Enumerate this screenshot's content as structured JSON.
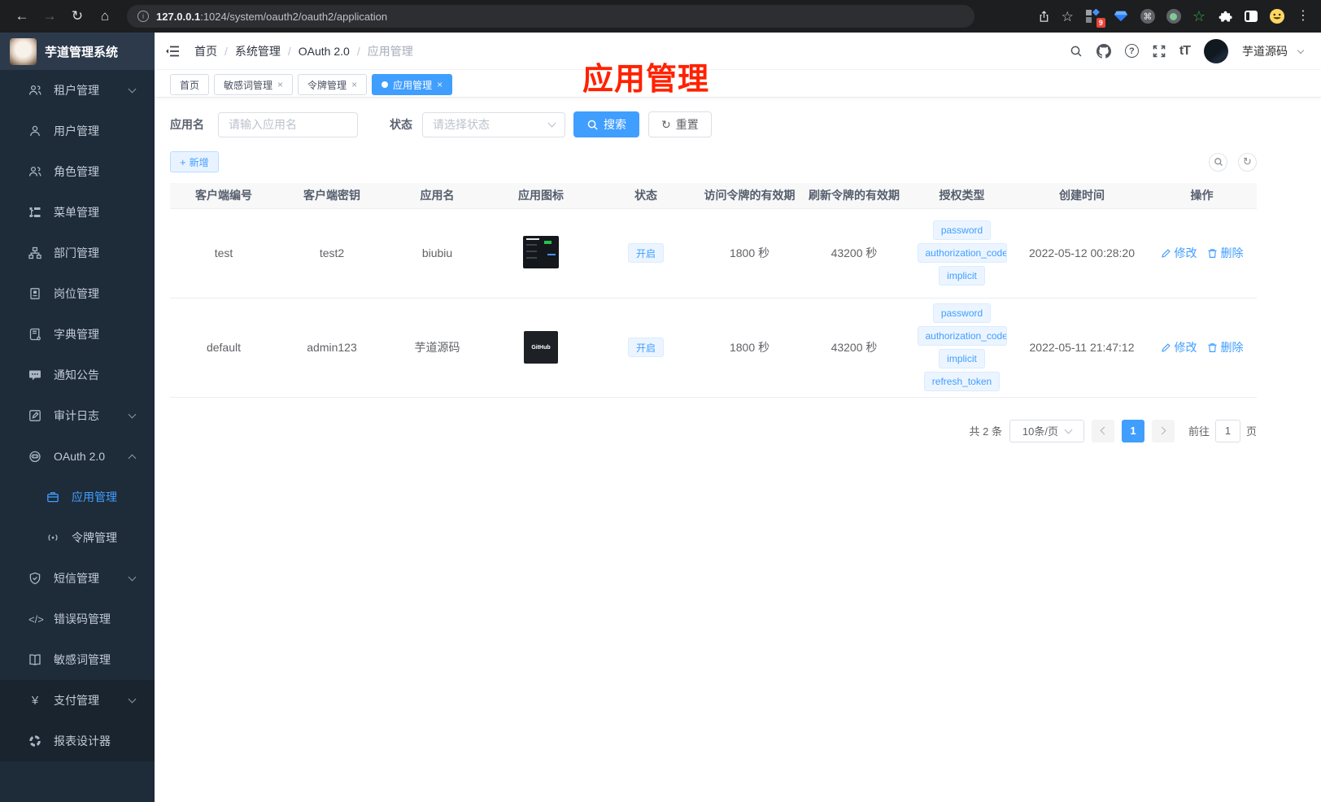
{
  "browser": {
    "url_host": "127.0.0.1",
    "url_path": ":1024/system/oauth2/oauth2/application",
    "extension_badge": "9"
  },
  "icons": {
    "back": "←",
    "forward": "→",
    "reload": "↻",
    "home": "⌂",
    "info": "i",
    "star": "☆",
    "more": "⋮",
    "command": "⌘",
    "question": "?",
    "font_size": "tT",
    "plus": "+",
    "close": "×",
    "code": "</>",
    "yen": "¥"
  },
  "sidebar": {
    "title": "芋道管理系统",
    "items": [
      {
        "label": "租户管理"
      },
      {
        "label": "用户管理"
      },
      {
        "label": "角色管理"
      },
      {
        "label": "菜单管理"
      },
      {
        "label": "部门管理"
      },
      {
        "label": "岗位管理"
      },
      {
        "label": "字典管理"
      },
      {
        "label": "通知公告"
      },
      {
        "label": "审计日志"
      },
      {
        "label": "OAuth 2.0"
      },
      {
        "label": "短信管理"
      },
      {
        "label": "错误码管理"
      },
      {
        "label": "敏感词管理"
      },
      {
        "label": "支付管理"
      },
      {
        "label": "报表设计器"
      }
    ],
    "oauth_children": [
      {
        "label": "应用管理",
        "active": true
      },
      {
        "label": "令牌管理"
      }
    ]
  },
  "header": {
    "breadcrumb": [
      "首页",
      "系统管理",
      "OAuth 2.0",
      "应用管理"
    ],
    "separator": "/",
    "username": "芋道源码"
  },
  "tabs": {
    "items": [
      {
        "label": "首页"
      },
      {
        "label": "敏感词管理",
        "closable": true
      },
      {
        "label": "令牌管理",
        "closable": true
      },
      {
        "label": "应用管理",
        "closable": true,
        "active": true
      }
    ]
  },
  "annotation": {
    "text": "应用管理",
    "color": "#ff2100"
  },
  "filters": {
    "name_label": "应用名",
    "name_placeholder": "请输入应用名",
    "status_label": "状态",
    "status_placeholder": "请选择状态",
    "search_label": "搜索",
    "reset_label": "重置"
  },
  "toolbar": {
    "add_label": "新增"
  },
  "table": {
    "columns": [
      "客户端编号",
      "客户端密钥",
      "应用名",
      "应用图标",
      "状态",
      "访问令牌的有效期",
      "刷新令牌的有效期",
      "授权类型",
      "创建时间",
      "操作"
    ],
    "action_edit": "修改",
    "action_delete": "删除",
    "rows": [
      {
        "client_id": "test",
        "secret": "test2",
        "name": "biubiu",
        "status": "开启",
        "access_ttl": "1800 秒",
        "refresh_ttl": "43200 秒",
        "grants": [
          "password",
          "authorization_code",
          "implicit"
        ],
        "created": "2022-05-12 00:28:20"
      },
      {
        "client_id": "default",
        "secret": "admin123",
        "name": "芋道源码",
        "status": "开启",
        "access_ttl": "1800 秒",
        "refresh_ttl": "43200 秒",
        "grants": [
          "password",
          "authorization_code",
          "implicit",
          "refresh_token"
        ],
        "created": "2022-05-11 21:47:12",
        "icon_label": "GitHub"
      }
    ]
  },
  "pagination": {
    "total": "共 2 条",
    "page_size": "10条/页",
    "current": "1",
    "goto_label": "前往",
    "goto_value": "1",
    "page_unit": "页"
  },
  "colors": {
    "accent": "#409eff",
    "annotation_red": "#ff2100",
    "sidebar_bg": "#1e2b39",
    "chrome_bg": "#1d1e20"
  }
}
